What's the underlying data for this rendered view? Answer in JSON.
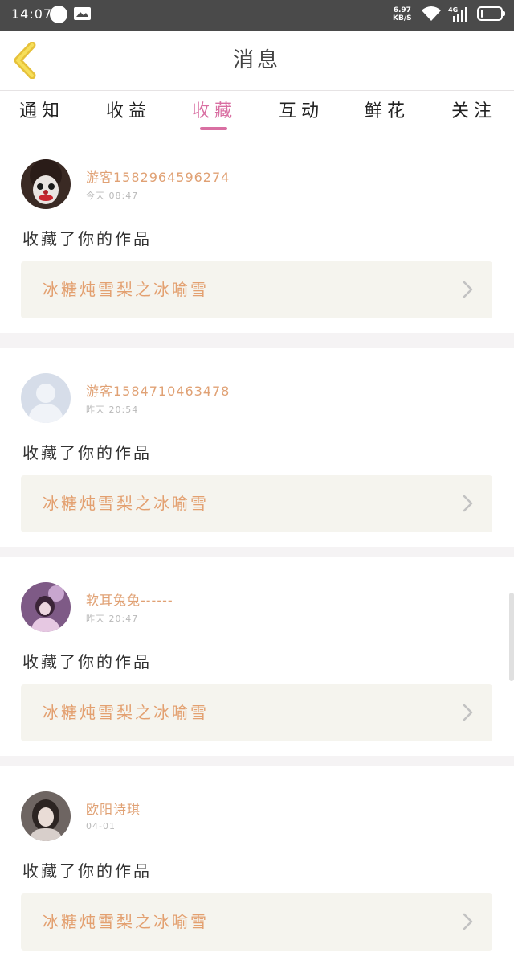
{
  "status_bar": {
    "time": "14:07",
    "net_speed_value": "6.97",
    "net_speed_unit": "KB/S",
    "network": "4G",
    "battery_level": "4",
    "battery_fraction": 0.04
  },
  "header": {
    "title": "消息",
    "back_icon": "chevron-left-icon",
    "accent": "#f2d13f"
  },
  "tabs": [
    {
      "label": "通知",
      "active": false
    },
    {
      "label": "收益",
      "active": false
    },
    {
      "label": "收藏",
      "active": true
    },
    {
      "label": "互动",
      "active": false
    },
    {
      "label": "鲜花",
      "active": false
    },
    {
      "label": "关注",
      "active": false
    }
  ],
  "colors": {
    "active_tab": "#d96fa2",
    "username": "#e0a174",
    "work_title": "#e3a070",
    "work_box_bg": "#f5f4ee"
  },
  "messages": [
    {
      "user": "游客1582964596274",
      "time": "今天 08:47",
      "action": "收藏了你的作品",
      "work": "冰糖炖雪梨之冰喻雪",
      "avatar": "clown-avatar"
    },
    {
      "user": "游客1584710463478",
      "time": "昨天 20:54",
      "action": "收藏了你的作品",
      "work": "冰糖炖雪梨之冰喻雪",
      "avatar": "default-avatar"
    },
    {
      "user": "软耳兔兔------",
      "time": "昨天 20:47",
      "action": "收藏了你的作品",
      "work": "冰糖炖雪梨之冰喻雪",
      "avatar": "girl-avatar"
    },
    {
      "user": "欧阳诗琪",
      "time": "04-01",
      "action": "收藏了你的作品",
      "work": "冰糖炖雪梨之冰喻雪",
      "avatar": "girl-avatar"
    }
  ]
}
